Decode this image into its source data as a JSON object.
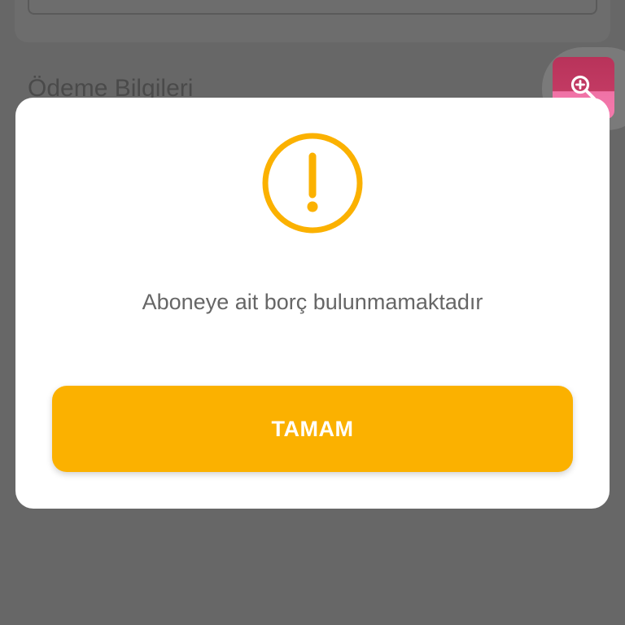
{
  "background": {
    "section_title": "Ödeme Bilgileri"
  },
  "zoom_button": {
    "icon": "zoom-in-icon",
    "color": "#c23a63"
  },
  "dialog": {
    "icon": "warning-circle-icon",
    "icon_color": "#fbb100",
    "message": "Aboneye ait borç bulunmamaktadır",
    "confirm_label": "TAMAM",
    "confirm_color": "#fbb100"
  }
}
